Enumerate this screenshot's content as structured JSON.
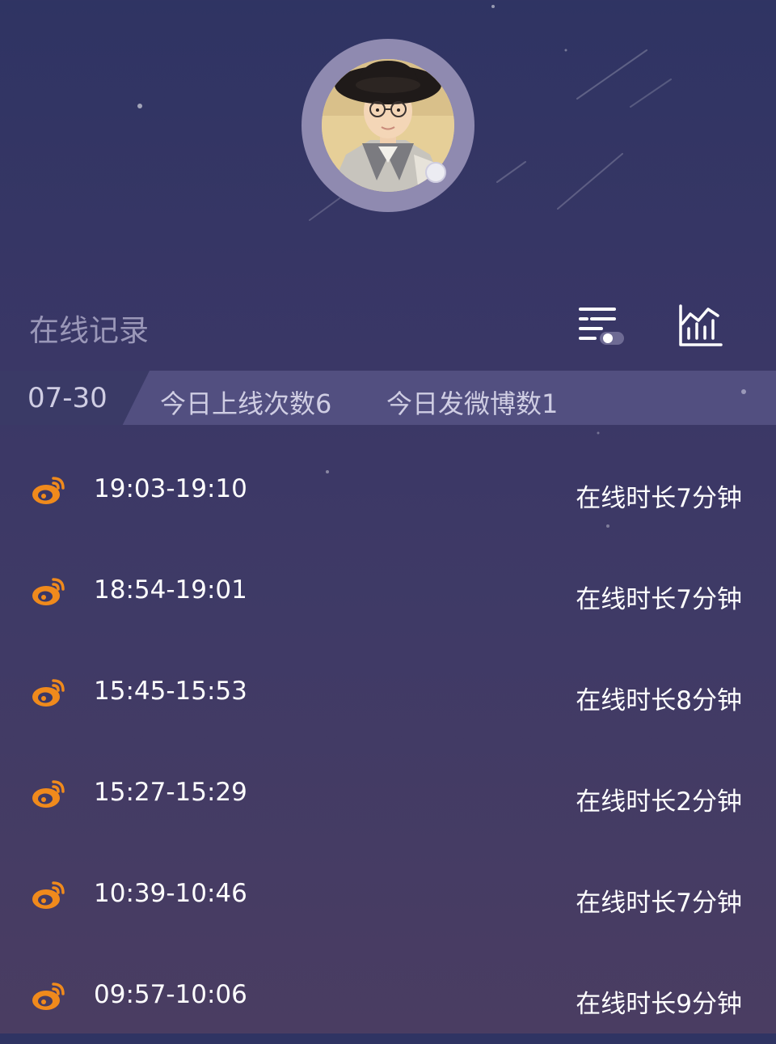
{
  "profile": {
    "avatar_icon": "profile-photo",
    "status": "offline-dot"
  },
  "section": {
    "title": "在线记录"
  },
  "toolbar": {
    "filter_icon": "filter-toggle-icon",
    "stats_icon": "bar-chart-icon"
  },
  "summary": {
    "date": "07-30",
    "online_count": "今日上线次数6",
    "weibo_count": "今日发微博数1"
  },
  "records": [
    {
      "time": "19:03-19:10",
      "duration": "在线时长7分钟",
      "icon": "weibo-icon"
    },
    {
      "time": "18:54-19:01",
      "duration": "在线时长7分钟",
      "icon": "weibo-icon"
    },
    {
      "time": "15:45-15:53",
      "duration": "在线时长8分钟",
      "icon": "weibo-icon"
    },
    {
      "time": "15:27-15:29",
      "duration": "在线时长2分钟",
      "icon": "weibo-icon"
    },
    {
      "time": "10:39-10:46",
      "duration": "在线时长7分钟",
      "icon": "weibo-icon"
    },
    {
      "time": "09:57-10:06",
      "duration": "在线时长9分钟",
      "icon": "weibo-icon"
    }
  ],
  "colors": {
    "accent": "#f08a1c",
    "background": "#36366a"
  }
}
